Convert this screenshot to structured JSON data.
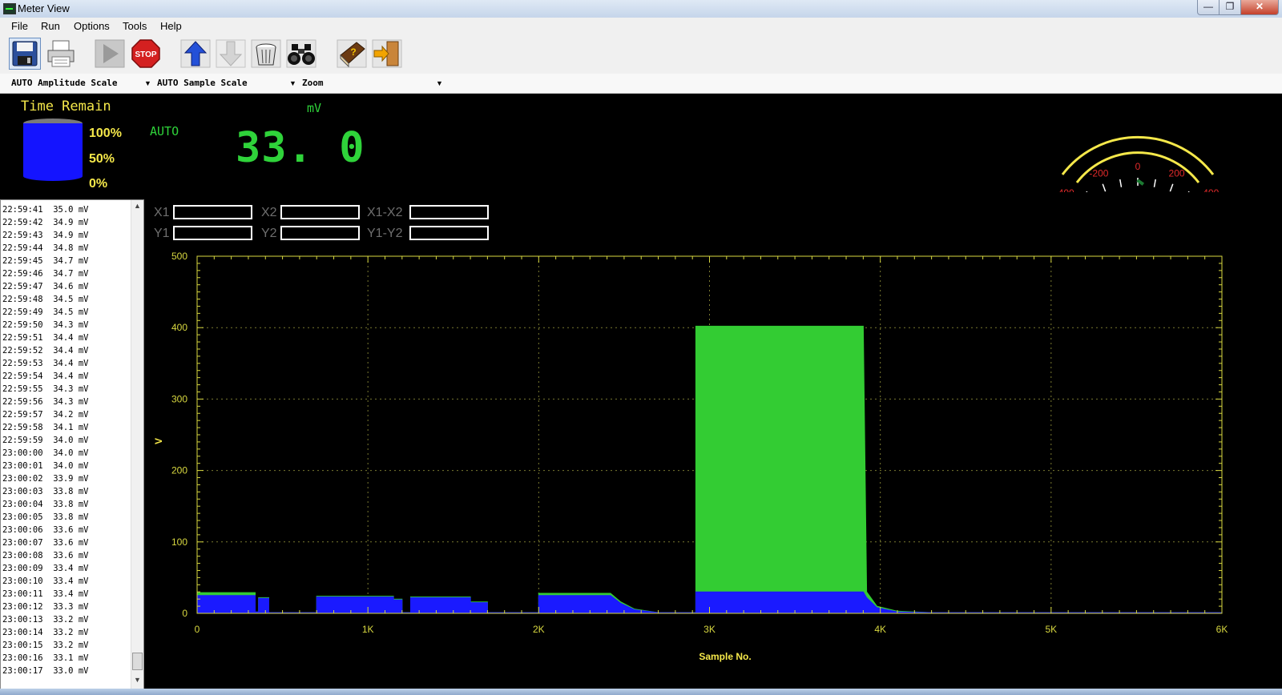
{
  "window": {
    "title": "Meter View",
    "min_glyph": "—",
    "max_glyph": "❐",
    "close_glyph": "✕"
  },
  "menu": [
    "File",
    "Run",
    "Options",
    "Tools",
    "Help"
  ],
  "toolbar": {
    "icons": [
      "save-icon",
      "print-icon",
      "play-icon",
      "stop-icon",
      "upload-icon",
      "download-icon",
      "trash-icon",
      "binoculars-icon",
      "book-icon",
      "exit-icon"
    ],
    "stop_text": "STOP"
  },
  "scale": {
    "amplitude": "AUTO Amplitude Scale",
    "sample": "AUTO Sample Scale",
    "zoom": "Zoom"
  },
  "meter": {
    "time_remain_label": "Time Remain",
    "tank_labels": [
      "100%",
      "50%",
      "0%"
    ],
    "tank_fill_fraction": 1.0,
    "mode": "AUTO",
    "unit": "mV",
    "reading": "33. 0"
  },
  "gauge": {
    "ticks": [
      "-400",
      "-200",
      "0",
      "200",
      "400"
    ],
    "needle_value": 33,
    "range": [
      -500,
      500
    ]
  },
  "log": [
    "22:59:41  35.0 mV",
    "22:59:42  34.9 mV",
    "22:59:43  34.9 mV",
    "22:59:44  34.8 mV",
    "22:59:45  34.7 mV",
    "22:59:46  34.7 mV",
    "22:59:47  34.6 mV",
    "22:59:48  34.5 mV",
    "22:59:49  34.5 mV",
    "22:59:50  34.3 mV",
    "22:59:51  34.4 mV",
    "22:59:52  34.4 mV",
    "22:59:53  34.4 mV",
    "22:59:54  34.4 mV",
    "22:59:55  34.3 mV",
    "22:59:56  34.3 mV",
    "22:59:57  34.2 mV",
    "22:59:58  34.1 mV",
    "22:59:59  34.0 mV",
    "23:00:00  34.0 mV",
    "23:00:01  34.0 mV",
    "23:00:02  33.9 mV",
    "23:00:03  33.8 mV",
    "23:00:04  33.8 mV",
    "23:00:05  33.8 mV",
    "23:00:06  33.6 mV",
    "23:00:07  33.6 mV",
    "23:00:08  33.6 mV",
    "23:00:09  33.4 mV",
    "23:00:10  33.4 mV",
    "23:00:11  33.4 mV",
    "23:00:12  33.3 mV",
    "23:00:13  33.2 mV",
    "23:00:14  33.2 mV",
    "23:00:15  33.2 mV",
    "23:00:16  33.1 mV",
    "23:00:17  33.0 mV"
  ],
  "cursors": {
    "x1": "X1",
    "x2": "X2",
    "x1_x2": "X1-X2",
    "y1": "Y1",
    "y2": "Y2",
    "y1_y2": "Y1-Y2",
    "x1_value": "",
    "x2_value": "",
    "x1_x2_value": "",
    "y1_value": "",
    "y2_value": "",
    "y1_y2_value": ""
  },
  "colors": {
    "series_a": "#33cc33",
    "series_b": "#1a1aff",
    "axis": "#d8d840",
    "grid": "#7a7a30"
  },
  "chart_data": {
    "type": "area",
    "xlabel": "Sample No.",
    "ylabel": "V",
    "xlim": [
      0,
      6000
    ],
    "ylim": [
      0,
      500
    ],
    "x_ticks": [
      0,
      1000,
      2000,
      3000,
      4000,
      5000,
      6000
    ],
    "x_tick_labels": [
      "0",
      "1K",
      "2K",
      "3K",
      "4K",
      "5K",
      "6K"
    ],
    "y_ticks": [
      0,
      100,
      200,
      300,
      400,
      500
    ],
    "y_tick_labels": [
      "0",
      "100",
      "200",
      "300",
      "400",
      "500"
    ],
    "grid": true,
    "series": [
      {
        "color": "#33cc33",
        "x": [
          0,
          0,
          340,
          340,
          360,
          360,
          420,
          420,
          700,
          700,
          1150,
          1150,
          1200,
          1200,
          1250,
          1250,
          1600,
          1600,
          1700,
          1700,
          2000,
          2000,
          2420,
          2480,
          2560,
          2700,
          2920,
          2920,
          3900,
          3920,
          3980,
          4100,
          4300,
          6000
        ],
        "y": [
          0,
          29,
          29,
          2,
          2,
          22,
          22,
          1,
          1,
          24,
          24,
          20,
          20,
          1,
          1,
          23,
          23,
          16,
          16,
          1,
          1,
          28,
          28,
          16,
          6,
          1,
          1,
          402,
          402,
          30,
          10,
          3,
          1,
          1
        ]
      },
      {
        "color": "#1a1aff",
        "x": [
          0,
          0,
          340,
          340,
          360,
          360,
          420,
          420,
          700,
          700,
          1150,
          1150,
          1200,
          1200,
          1250,
          1250,
          1600,
          1600,
          1700,
          1700,
          2000,
          2000,
          2420,
          2480,
          2560,
          2700,
          2920,
          2920,
          3900,
          3920,
          3980,
          4100,
          4300,
          6000
        ],
        "y": [
          0,
          25,
          25,
          2,
          2,
          21,
          21,
          1,
          1,
          23,
          23,
          19,
          19,
          1,
          1,
          22,
          22,
          15,
          15,
          1,
          1,
          25,
          25,
          14,
          5,
          1,
          1,
          30,
          30,
          22,
          8,
          2,
          1,
          1
        ]
      }
    ]
  }
}
